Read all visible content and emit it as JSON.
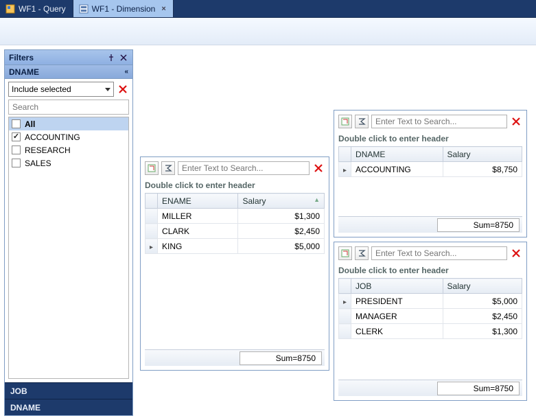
{
  "tabs": [
    {
      "label": "WF1 - Query",
      "active": false,
      "icon": "query"
    },
    {
      "label": "WF1 - Dimension",
      "active": true,
      "icon": "dimension"
    }
  ],
  "filters_panel": {
    "title": "Filters",
    "sub_title": "DNAME",
    "mode_label": "Include selected",
    "search_placeholder": "Search",
    "items": [
      {
        "label": "All",
        "checked": false,
        "selected": true,
        "bold": true
      },
      {
        "label": "ACCOUNTING",
        "checked": true,
        "selected": false,
        "bold": false
      },
      {
        "label": "RESEARCH",
        "checked": false,
        "selected": false,
        "bold": false
      },
      {
        "label": "SALES",
        "checked": false,
        "selected": false,
        "bold": false
      }
    ],
    "bottom_bars": [
      "JOB",
      "DNAME"
    ]
  },
  "common": {
    "search_placeholder": "Enter Text to Search...",
    "header_hint": "Double click to enter header"
  },
  "grid_ename": {
    "columns": [
      "ENAME",
      "Salary"
    ],
    "rows": [
      {
        "ename": "MILLER",
        "salary": "$1,300",
        "active": false
      },
      {
        "ename": "CLARK",
        "salary": "$2,450",
        "active": false
      },
      {
        "ename": "KING",
        "salary": "$5,000",
        "active": true
      }
    ],
    "footer_sum": "Sum=8750"
  },
  "grid_dname": {
    "columns": [
      "DNAME",
      "Salary"
    ],
    "rows": [
      {
        "dname": "ACCOUNTING",
        "salary": "$8,750",
        "active": true
      }
    ],
    "footer_sum": "Sum=8750"
  },
  "grid_job": {
    "columns": [
      "JOB",
      "Salary"
    ],
    "rows": [
      {
        "job": "PRESIDENT",
        "salary": "$5,000",
        "active": true
      },
      {
        "job": "MANAGER",
        "salary": "$2,450",
        "active": false
      },
      {
        "job": "CLERK",
        "salary": "$1,300",
        "active": false
      }
    ],
    "footer_sum": "Sum=8750"
  },
  "chart_data": [
    {
      "type": "table",
      "title": "ENAME / Salary",
      "categories": [
        "ENAME",
        "Salary"
      ],
      "rows": [
        [
          "MILLER",
          1300
        ],
        [
          "CLARK",
          2450
        ],
        [
          "KING",
          5000
        ]
      ],
      "sum": 8750
    },
    {
      "type": "table",
      "title": "DNAME / Salary",
      "categories": [
        "DNAME",
        "Salary"
      ],
      "rows": [
        [
          "ACCOUNTING",
          8750
        ]
      ],
      "sum": 8750
    },
    {
      "type": "table",
      "title": "JOB / Salary",
      "categories": [
        "JOB",
        "Salary"
      ],
      "rows": [
        [
          "PRESIDENT",
          5000
        ],
        [
          "MANAGER",
          2450
        ],
        [
          "CLERK",
          1300
        ]
      ],
      "sum": 8750
    }
  ]
}
